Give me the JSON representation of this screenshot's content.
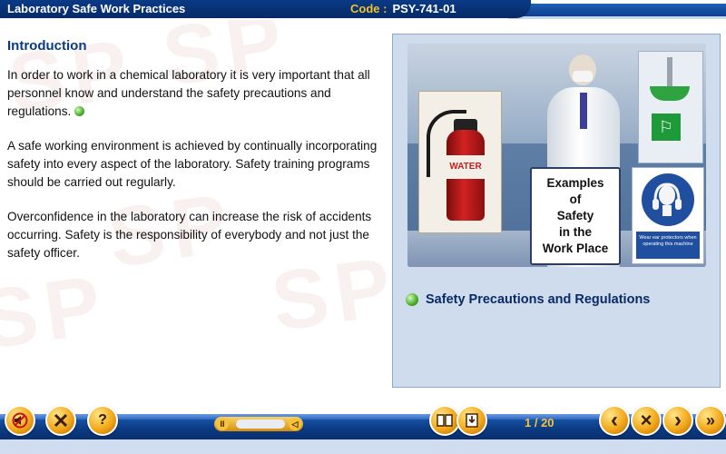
{
  "header": {
    "title": "Laboratory Safe Work Practices",
    "code_label": "Code :",
    "code_value": "PSY-741-01"
  },
  "watermark": {
    "text": "SP"
  },
  "main": {
    "heading": "Introduction",
    "paragraphs": [
      "In order to work in a chemical laboratory it is very important that all personnel know and understand the safety precautions and regulations.",
      "A safe working environment is achieved by continually incorporating safety into every aspect of the laboratory. Safety training programs should be carried out regularly.",
      "Overconfidence in the laboratory can increase the risk of accidents occurring. Safety is the responsibility of everybody and not just the safety officer."
    ]
  },
  "panel": {
    "extinguisher_label": "WATER",
    "caption_lines": [
      "Examples",
      "of",
      "Safety",
      "in the",
      "Work Place"
    ],
    "ear_sign_text": "Wear ear protectors when operating this machine",
    "title": "Safety Precautions and Regulations"
  },
  "toolbar": {
    "page_counter": "1 / 20",
    "buttons": {
      "tools": "tools-icon",
      "help": "?",
      "prev": "‹",
      "close": "×",
      "next": "›",
      "last": "»"
    }
  },
  "colors": {
    "header_bg": "#0a3a86",
    "code_label": "#f2c12e",
    "heading": "#0a3a86",
    "panel_bg": "#cfdcee",
    "toolbar_bg": "#0b3a82",
    "button_gold": "#f2a91a"
  }
}
